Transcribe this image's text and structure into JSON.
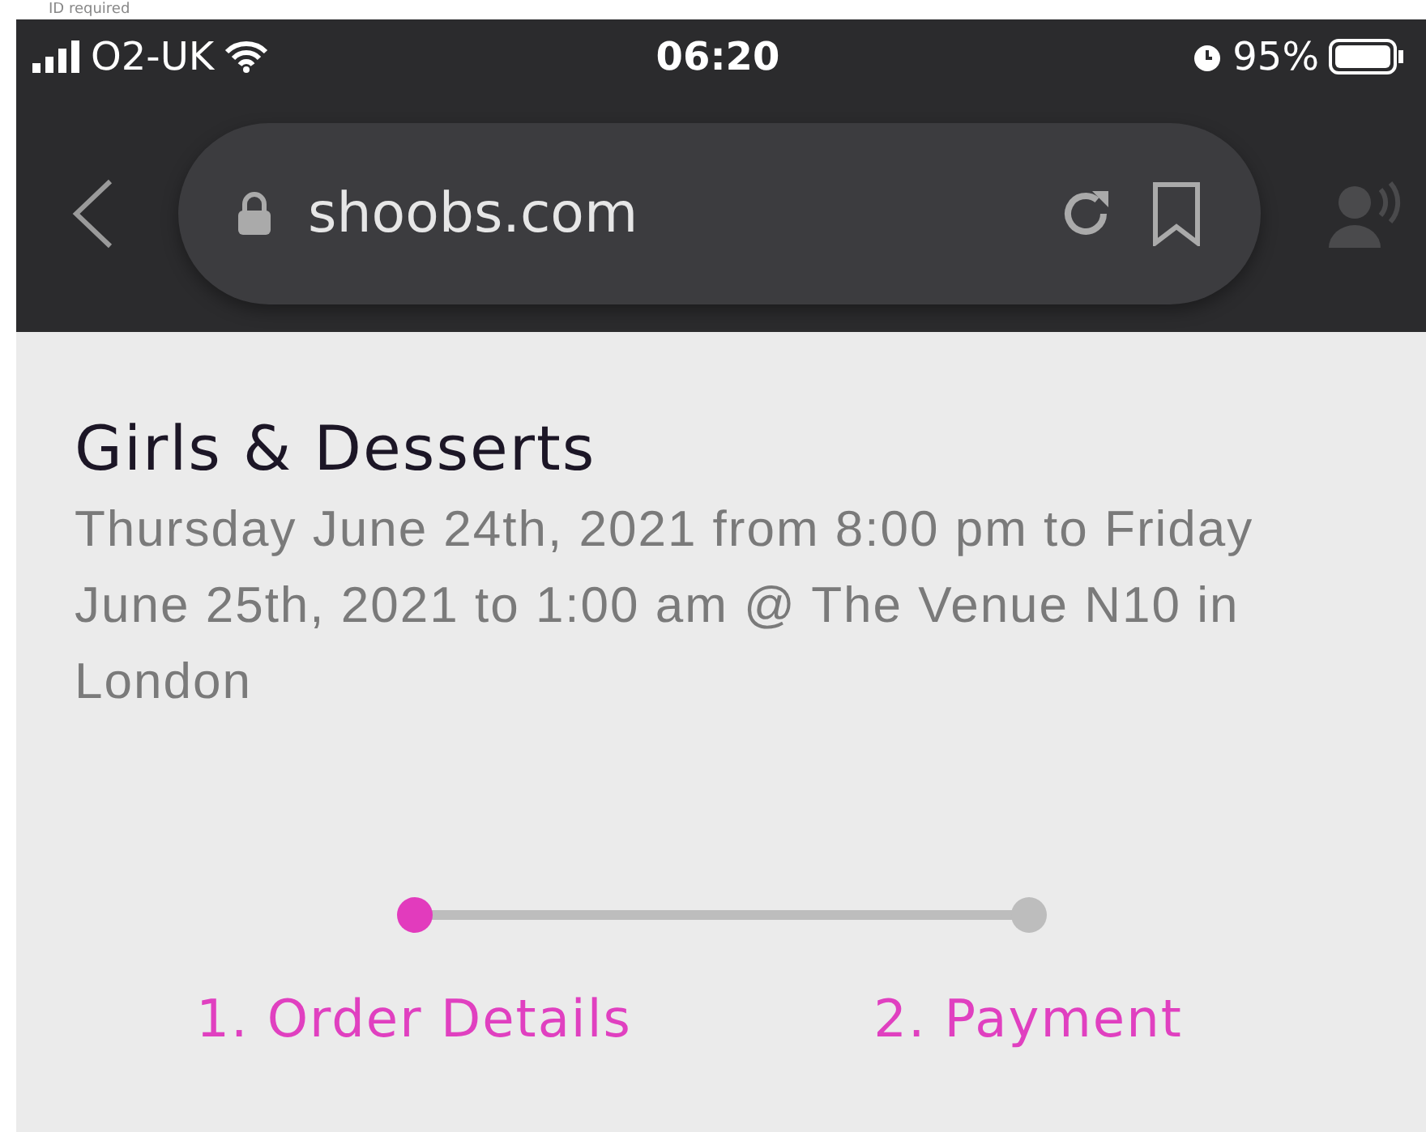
{
  "page_note": "ID required",
  "status_bar": {
    "carrier": "O2-UK",
    "time": "06:20",
    "battery": "95%"
  },
  "browser": {
    "url": "shoobs.com"
  },
  "event": {
    "title": "Girls & Desserts",
    "details": "Thursday June 24th, 2021 from 8:00 pm to Friday June 25th, 2021 to 1:00 am @ The Venue N10 in London"
  },
  "steps": [
    {
      "label": "1. Order Details",
      "selected": true
    },
    {
      "label": "2. Payment",
      "selected": false
    }
  ]
}
